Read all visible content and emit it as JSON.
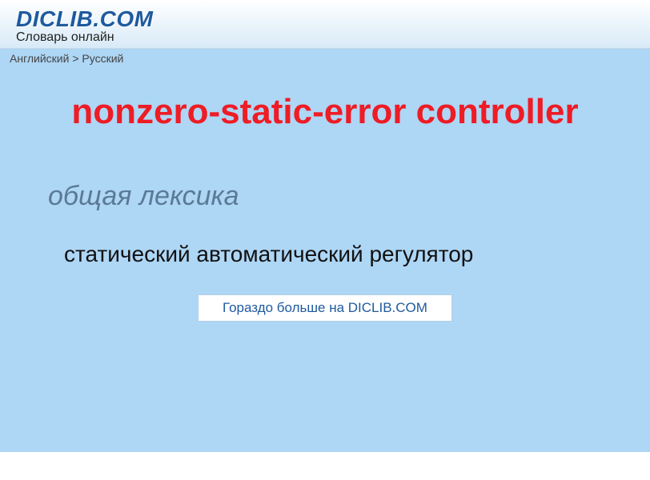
{
  "header": {
    "logo": "DICLIB.COM",
    "tagline": "Словарь онлайн"
  },
  "breadcrumb": "Английский > Русский",
  "entry": {
    "term": "nonzero-static-error controller",
    "category": "общая лексика",
    "definition": "статический автоматический регулятор"
  },
  "morelink": "Гораздо больше на DICLIB.COM"
}
